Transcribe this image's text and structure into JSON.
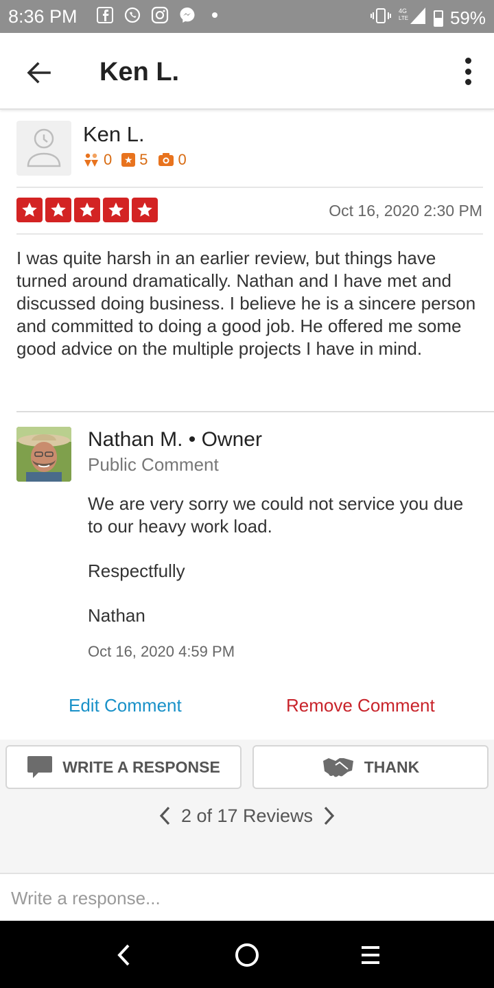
{
  "status_bar": {
    "time": "8:36 PM",
    "network": "4G LTE",
    "battery": "59%",
    "icons": [
      "facebook-icon",
      "whatsapp-icon",
      "instagram-icon",
      "messenger-icon",
      "dot-icon"
    ]
  },
  "app_bar": {
    "title": "Ken L."
  },
  "reviewer": {
    "name": "Ken L.",
    "friends": "0",
    "reviews": "5",
    "photos": "0"
  },
  "review": {
    "rating": 5,
    "date": "Oct 16, 2020 2:30 PM",
    "text": "I was quite harsh in an earlier review, but things have turned around dramatically. Nathan and I have met and discussed doing business. I believe he is a sincere person and committed to doing a good job. He offered me some good advice on the multiple projects I have in mind."
  },
  "owner_comment": {
    "name": "Nathan M. • Owner",
    "subtitle": "Public Comment",
    "text_line1": "We are very sorry we could not service you due to our heavy work load.",
    "text_line2": "Respectfully",
    "text_line3": "Nathan",
    "date": "Oct 16, 2020 4:59 PM",
    "edit_label": "Edit Comment",
    "remove_label": "Remove Comment"
  },
  "actions": {
    "write_label": "WRITE A RESPONSE",
    "thank_label": "THANK"
  },
  "pager": {
    "label": "2 of 17 Reviews"
  },
  "response": {
    "placeholder": "Write a response..."
  },
  "colors": {
    "star_red": "#d32323",
    "link_blue": "#1991c8",
    "remove_red": "#c8232a",
    "stat_orange": "#e8731e"
  }
}
